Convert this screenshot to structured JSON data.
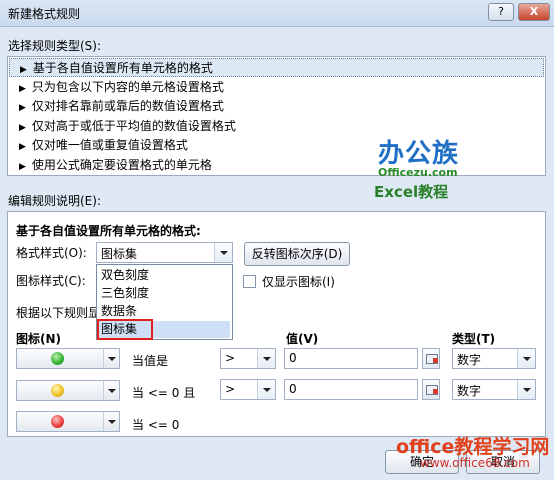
{
  "window": {
    "title": "新建格式规则",
    "help_label": "?",
    "close_label": "X"
  },
  "rule_type_section": {
    "label": "选择规则类型(S):",
    "items": [
      "基于各自值设置所有单元格的格式",
      "只为包含以下内容的单元格设置格式",
      "仅对排名靠前或靠后的数值设置格式",
      "仅对高于或低于平均值的数值设置格式",
      "仅对唯一值或重复值设置格式",
      "使用公式确定要设置格式的单元格"
    ],
    "arrow": "▶"
  },
  "watermark": {
    "logo": "办公族",
    "site": "Officezu.com",
    "tagline": "Excel教程",
    "bottom_site": "office教程学习网",
    "bottom_url": "www.office68.com"
  },
  "edit_section": {
    "label": "编辑规则说明(E):",
    "heading": "基于各自值设置所有单元格的格式:",
    "format_style_label": "格式样式(O):",
    "format_style_value": "图标集",
    "reverse_button": "反转图标次序(D)",
    "icon_style_label": "图标样式(C):",
    "show_icon_only": "仅显示图标(I)",
    "rules_label": "根据以下规则显",
    "dropdown_options": [
      "双色刻度",
      "三色刻度",
      "数据条",
      "图标集"
    ],
    "col_icon": "图标(N)",
    "col_value": "值(V)",
    "col_type": "类型(T)",
    "rows": [
      {
        "condition": "当值是",
        "operator": ">",
        "value": "0",
        "type": "数字",
        "color": "#2fb02f"
      },
      {
        "condition": "当 <= 0 且",
        "operator": ">",
        "value": "0",
        "type": "数字",
        "color": "#f0c020"
      },
      {
        "condition": "当 <= 0",
        "color": "#e83a3a"
      }
    ]
  },
  "footer": {
    "ok": "确定",
    "cancel": "取消"
  }
}
